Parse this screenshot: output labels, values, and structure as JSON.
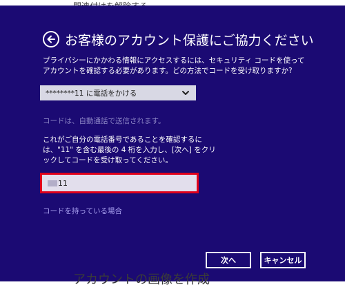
{
  "background": {
    "top_text": "関連付けを解除する",
    "bottom_text": "アカウントの画像を作成"
  },
  "dialog": {
    "title": "お客様のアカウント保護にご協力ください",
    "description": "プライバシーにかかわる情報にアクセスするには、セキュリティ コードを使ってアカウントを確認する必要があります。どの方法でコードを受け取りますか?",
    "method_select": {
      "selected": "********11 に電話をかける"
    },
    "hint": "コードは、自動通話で送信されます。",
    "instruction": "これがご自分の電話番号であることを確認するには、\"11\" を含む最後の 4 桁を入力し、[次へ] をクリックしてコードを受け取ってください。",
    "code_input": {
      "value": "11"
    },
    "have_code_link": "コードを持っている場合",
    "buttons": {
      "next": "次へ",
      "cancel": "キャンセル"
    }
  },
  "colors": {
    "dialog_bg": "#1b0a73",
    "input_focus_border": "#e0001b",
    "link": "#a9a1f0",
    "hint": "#8a83c4"
  },
  "icons": {
    "back": "back-arrow-circle-icon",
    "dropdown": "chevron-down-icon"
  }
}
